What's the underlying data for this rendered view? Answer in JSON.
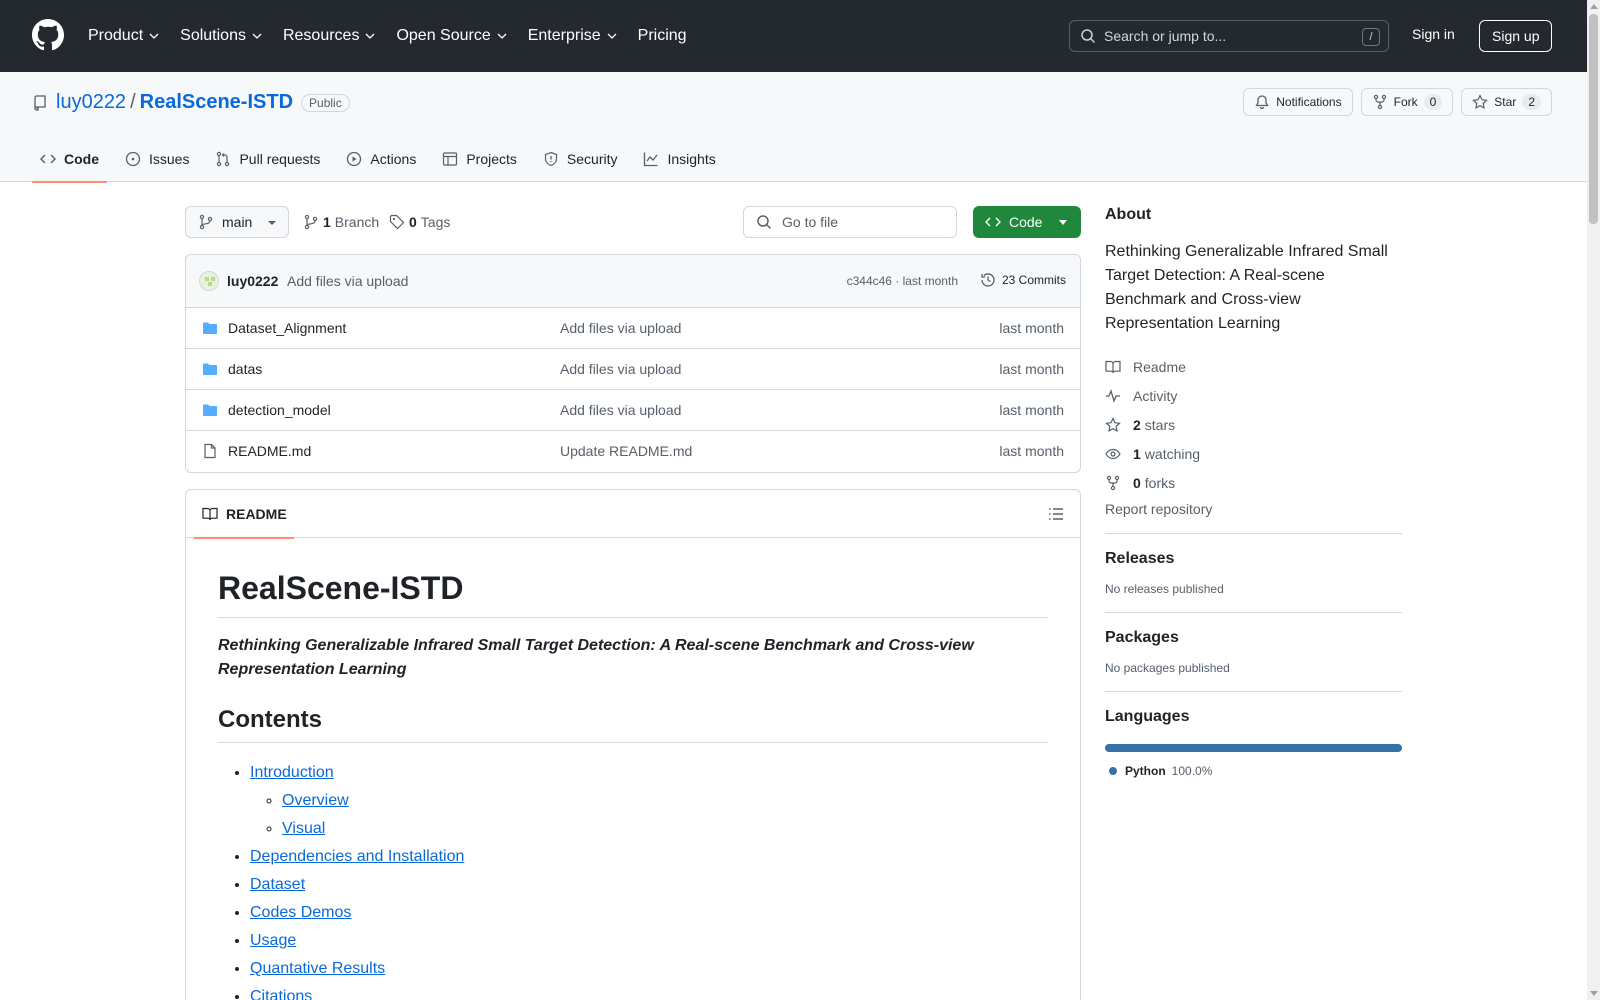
{
  "header": {
    "nav": [
      {
        "label": "Product",
        "dropdown": true
      },
      {
        "label": "Solutions",
        "dropdown": true
      },
      {
        "label": "Resources",
        "dropdown": true
      },
      {
        "label": "Open Source",
        "dropdown": true
      },
      {
        "label": "Enterprise",
        "dropdown": true
      },
      {
        "label": "Pricing",
        "dropdown": false
      }
    ],
    "search_placeholder": "Search or jump to...",
    "search_shortcut": "/",
    "sign_in": "Sign in",
    "sign_up": "Sign up"
  },
  "repo": {
    "owner": "luy0222",
    "separator": "/",
    "name": "RealScene-ISTD",
    "visibility": "Public",
    "notifications_label": "Notifications",
    "fork_label": "Fork",
    "fork_count": "0",
    "star_label": "Star",
    "star_count": "2",
    "tabs": [
      {
        "label": "Code",
        "icon": "code-icon",
        "selected": true
      },
      {
        "label": "Issues",
        "icon": "issue-icon",
        "selected": false
      },
      {
        "label": "Pull requests",
        "icon": "pull-request-icon",
        "selected": false
      },
      {
        "label": "Actions",
        "icon": "play-icon",
        "selected": false
      },
      {
        "label": "Projects",
        "icon": "table-icon",
        "selected": false
      },
      {
        "label": "Security",
        "icon": "shield-icon",
        "selected": false
      },
      {
        "label": "Insights",
        "icon": "graph-icon",
        "selected": false
      }
    ]
  },
  "toolbar": {
    "branch": "main",
    "branch_count": "1",
    "branch_label": "Branch",
    "tag_count": "0",
    "tag_label": "Tags",
    "goto_placeholder": "Go to file",
    "code_button": "Code"
  },
  "latest_commit": {
    "author": "luy0222",
    "message": "Add files via upload",
    "meta": "c344c46 · last month",
    "commits_label": "23 Commits"
  },
  "files": [
    {
      "type": "folder",
      "name": "Dataset_Alignment",
      "message": "Add files via upload",
      "date": "last month"
    },
    {
      "type": "folder",
      "name": "datas",
      "message": "Add files via upload",
      "date": "last month"
    },
    {
      "type": "folder",
      "name": "detection_model",
      "message": "Add files via upload",
      "date": "last month"
    },
    {
      "type": "file",
      "name": "README.md",
      "message": "Update README.md",
      "date": "last month"
    }
  ],
  "readme": {
    "tab_label": "README",
    "title": "RealScene-ISTD",
    "subtitle": "Rethinking Generalizable Infrared Small Target Detection: A Real-scene Benchmark and Cross-view Representation Learning",
    "contents_heading": "Contents",
    "toc": {
      "introduction": "Introduction",
      "overview": "Overview",
      "visual": "Visual",
      "dependencies": "Dependencies and Installation",
      "dataset": "Dataset",
      "codes_demos": "Codes Demos",
      "usage": "Usage",
      "quantative_results": "Quantative Results",
      "citations": "Citations"
    }
  },
  "about": {
    "heading": "About",
    "description": "Rethinking Generalizable Infrared Small Target Detection: A Real-scene Benchmark and Cross-view Representation Learning",
    "readme": "Readme",
    "activity": "Activity",
    "stars_count": "2",
    "stars_label": "stars",
    "watching_count": "1",
    "watching_label": "watching",
    "forks_count": "0",
    "forks_label": "forks",
    "report": "Report repository"
  },
  "releases": {
    "heading": "Releases",
    "note": "No releases published"
  },
  "packages": {
    "heading": "Packages",
    "note": "No packages published"
  },
  "languages": {
    "heading": "Languages",
    "items": [
      {
        "name": "Python",
        "percent": "100.0%",
        "fraction": 1.0,
        "color": "#3572A5"
      }
    ]
  },
  "colors": {
    "header_bg": "#24292f",
    "link": "#0969da",
    "code_button": "#1f883d",
    "selected_tab_underline": "#fd8c73"
  }
}
